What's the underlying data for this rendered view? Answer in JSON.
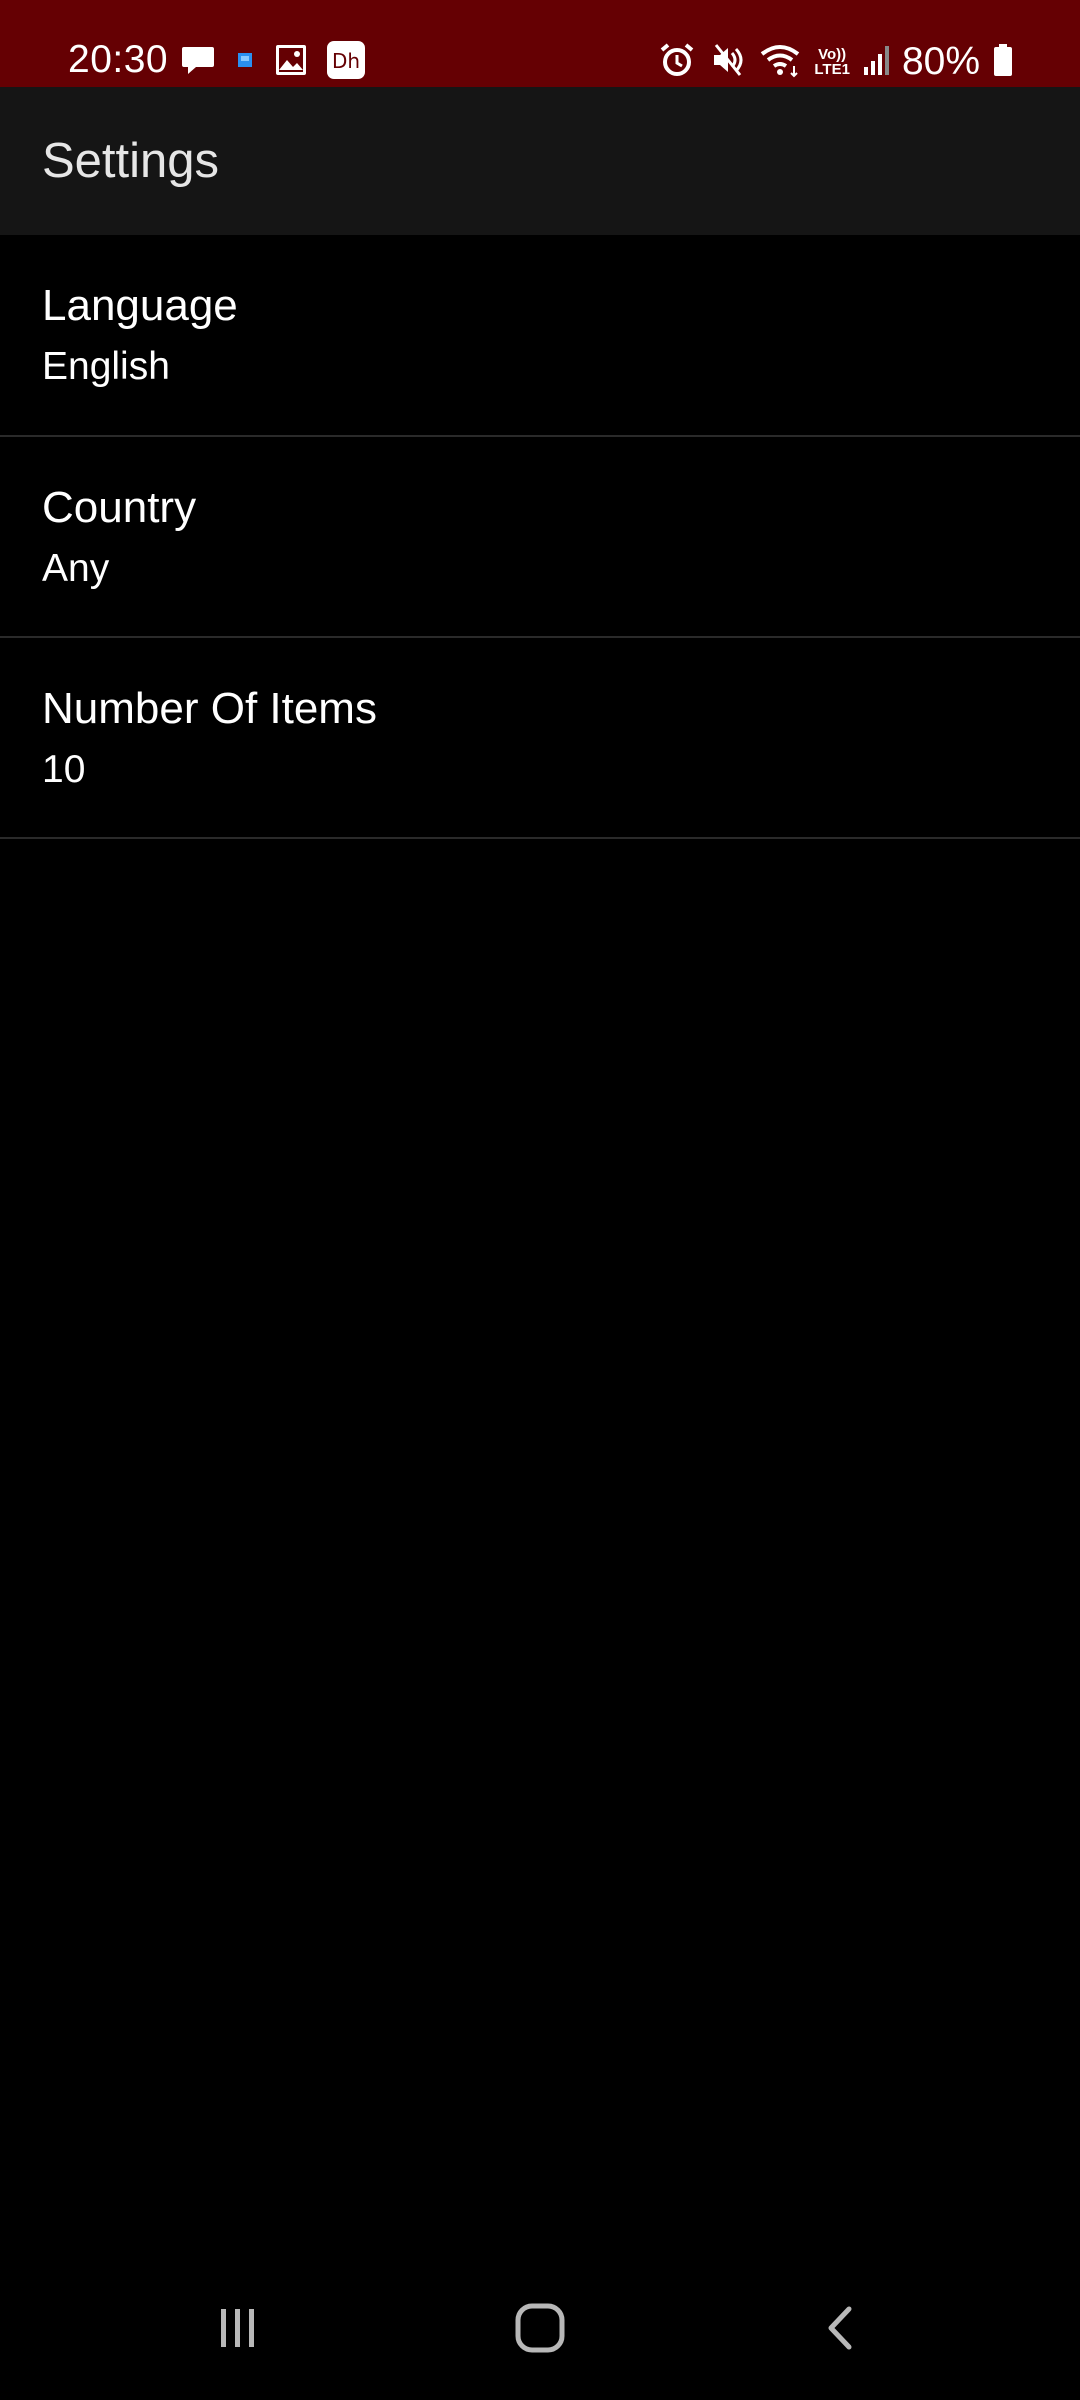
{
  "status_bar": {
    "time": "20:30",
    "battery": "80%",
    "background_color": "#650003",
    "left_icons": [
      "message-icon",
      "app-notification-icon",
      "gallery-icon",
      "dh-app-icon"
    ],
    "right_icons": [
      "alarm-icon",
      "mute-icon",
      "wifi-icon",
      "volte-icon",
      "signal-icon",
      "battery-icon"
    ],
    "volte_label_top": "Vo))",
    "volte_label_bottom": "LTE1"
  },
  "app_bar": {
    "title": "Settings",
    "background_color": "#151515"
  },
  "settings": {
    "items": [
      {
        "title": "Language",
        "value": "English"
      },
      {
        "title": "Country",
        "value": "Any"
      },
      {
        "title": "Number Of Items",
        "value": "10"
      }
    ]
  },
  "nav_bar": {
    "buttons": [
      "recent-apps-icon",
      "home-icon",
      "back-icon"
    ]
  }
}
